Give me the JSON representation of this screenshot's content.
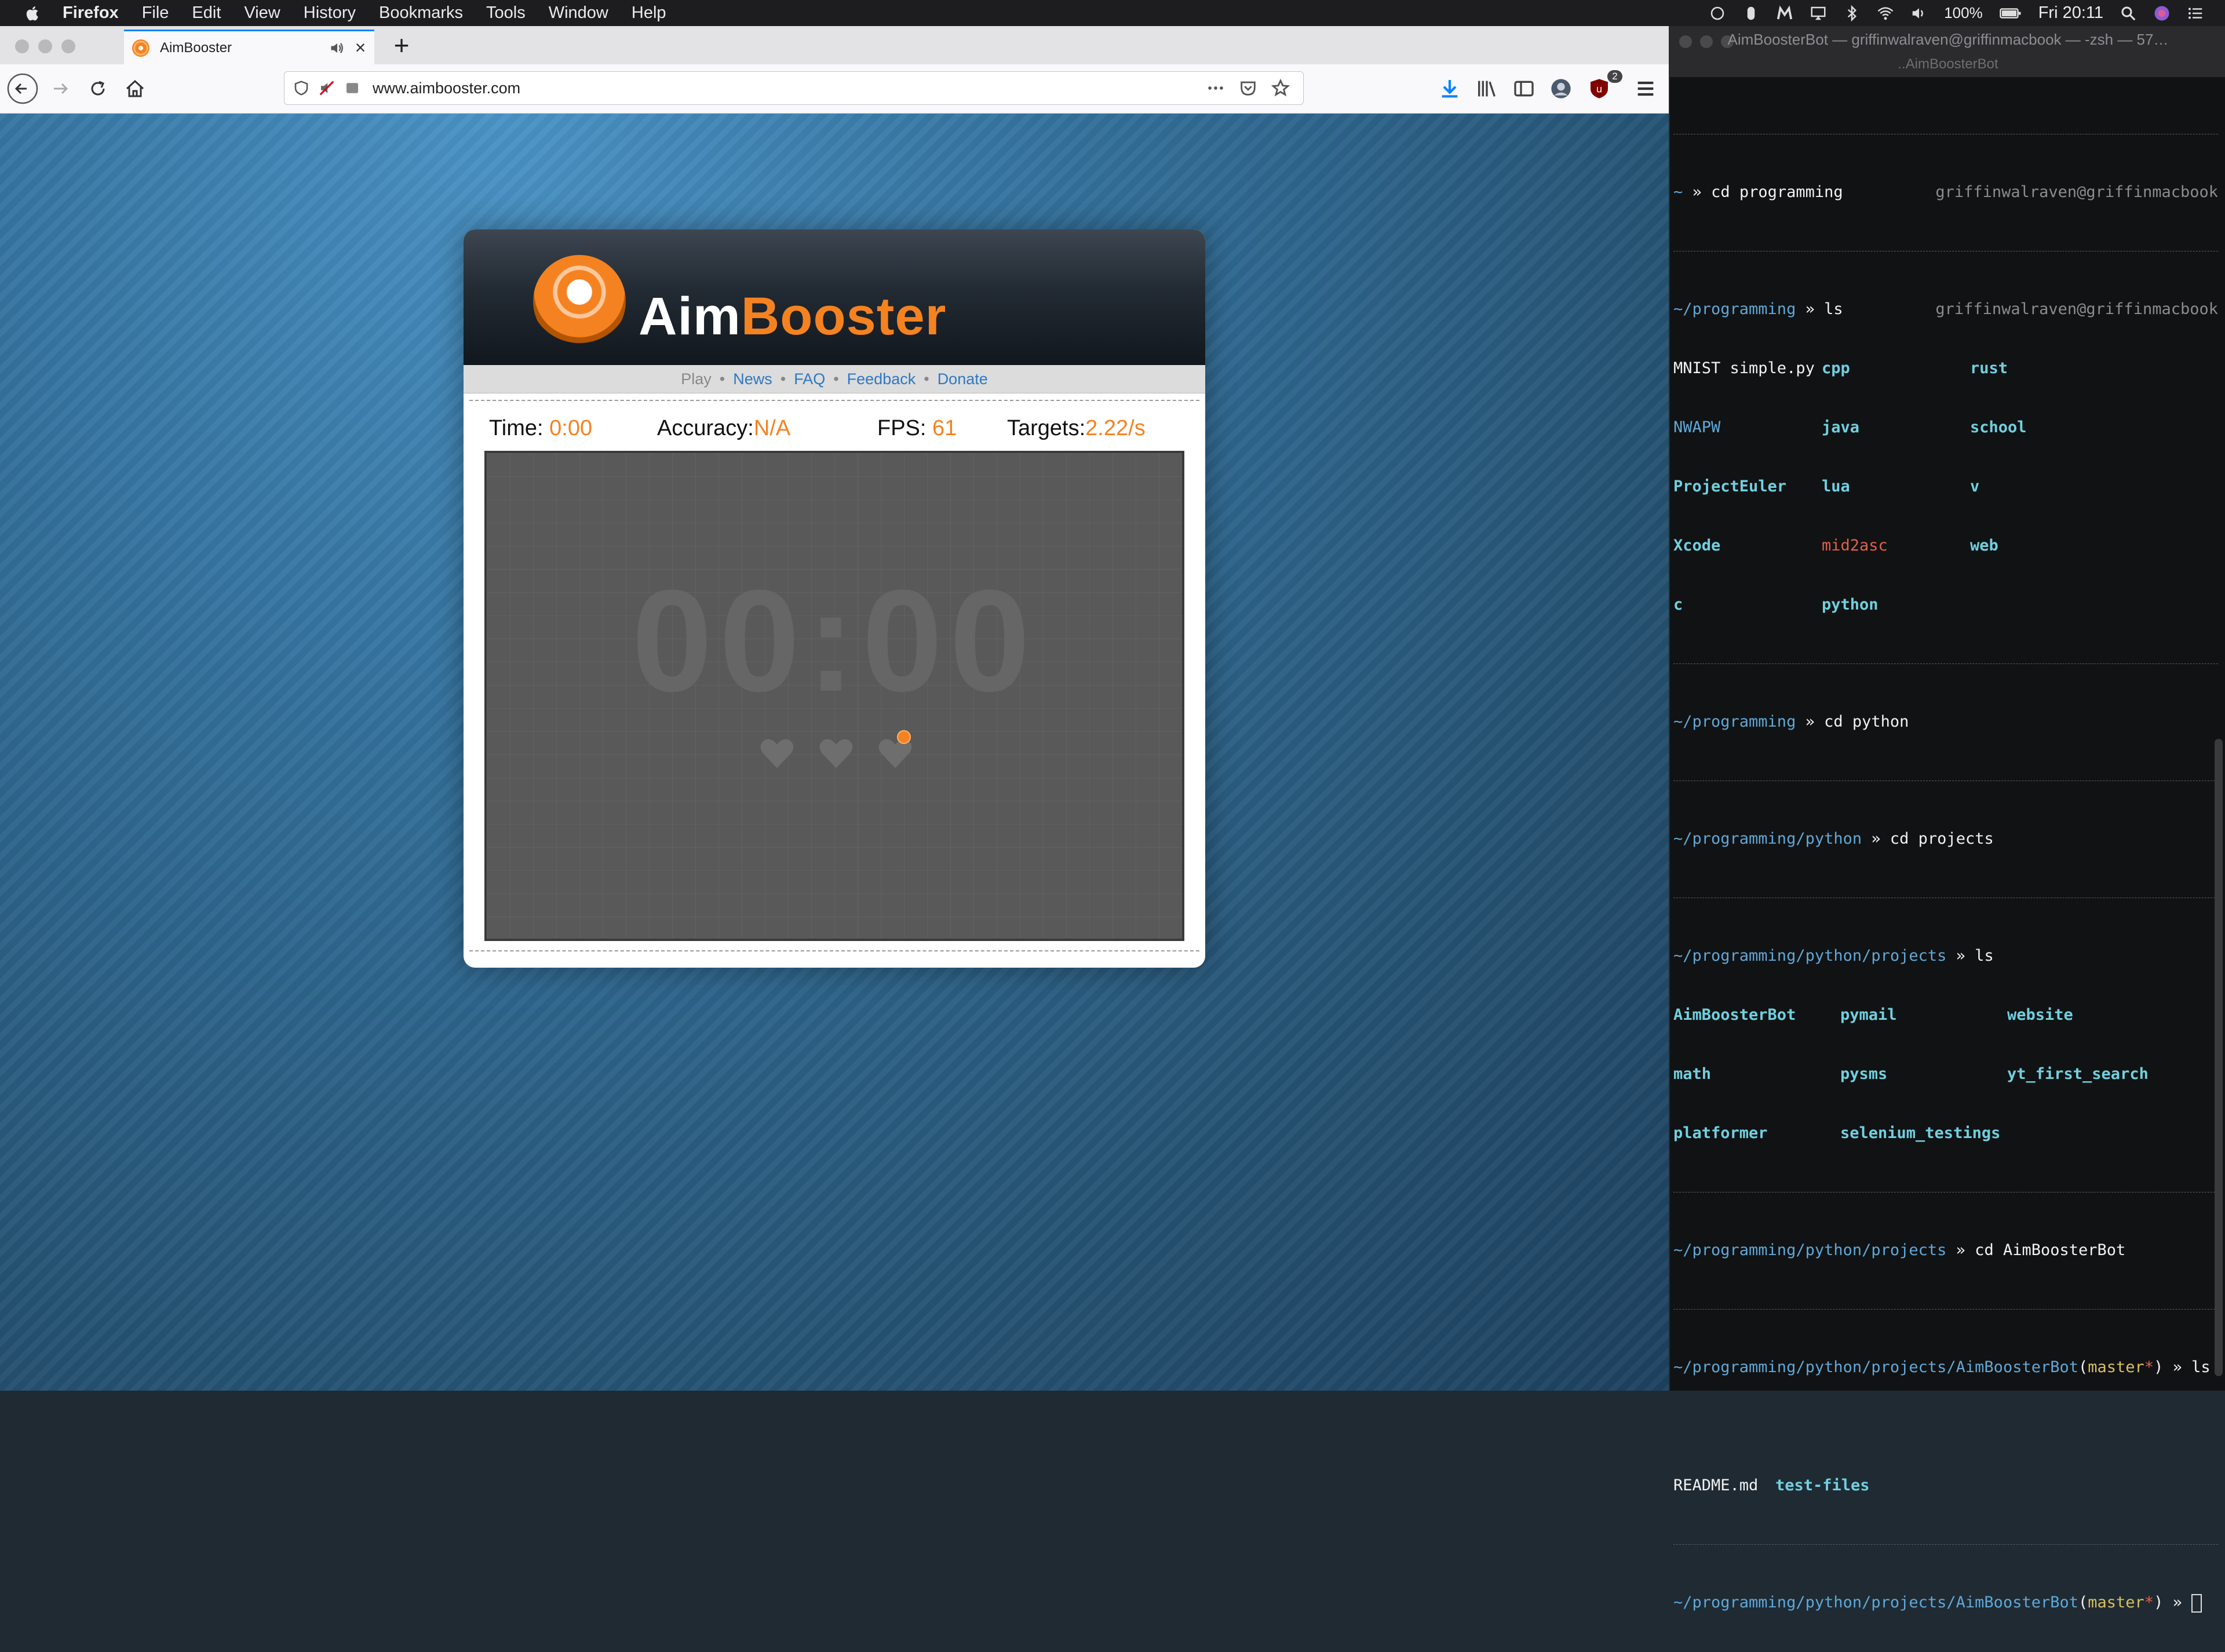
{
  "menubar": {
    "app_name": "Firefox",
    "menus": [
      "File",
      "Edit",
      "View",
      "History",
      "Bookmarks",
      "Tools",
      "Window",
      "Help"
    ],
    "battery": "100%",
    "clock": "Fri 20:11"
  },
  "browser": {
    "tab_title": "AimBooster",
    "url": "www.aimbooster.com"
  },
  "aimbooster": {
    "logo_aim": "Aim",
    "logo_booster": "Booster",
    "nav": {
      "play": "Play",
      "news": "News",
      "faq": "FAQ",
      "feedback": "Feedback",
      "donate": "Donate",
      "separator": "•"
    },
    "stats": {
      "time_label": "Time:",
      "time_value": "0:00",
      "accuracy_label": "Accuracy:",
      "accuracy_value": "N/A",
      "fps_label": "FPS:",
      "fps_value": "61",
      "targets_label": "Targets:",
      "targets_value": "2.22/s"
    },
    "big_timer": "00:00",
    "lives": 3,
    "accent_color": "#f58220"
  },
  "terminal": {
    "window_title": "AimBoosterBot — griffinwalraven@griffinmacbook — -zsh — 57…",
    "tab_title": "..AimBoosterBot",
    "host": "griffinwalraven@griffinmacbook",
    "prompts": {
      "home": "~",
      "programming": "~/programming",
      "python": "~/programming/python",
      "projects": "~/programming/python/projects",
      "bot": "~/programming/python/projects/AimBoosterBot"
    },
    "arrow": "»",
    "commands": {
      "cd_programming": "cd programming",
      "ls1": "ls",
      "cd_python": "cd python",
      "cd_projects": "cd projects",
      "ls2": "ls",
      "cd_bot": "cd AimBoosterBot",
      "ls3": "ls"
    },
    "git_branch": "master",
    "git_dirty": "*",
    "ls_programming": {
      "col1": [
        "MNIST simple.py",
        "NWAPW",
        "ProjectEuler",
        "Xcode",
        "c"
      ],
      "col2": [
        "cpp",
        "java",
        "lua",
        "mid2asc",
        "python"
      ],
      "col3": [
        "rust",
        "school",
        "v",
        "web"
      ]
    },
    "ls_projects": {
      "col1": [
        "AimBoosterBot",
        "math",
        "platformer"
      ],
      "col2": [
        "pymail",
        "pysms",
        "selenium_testings"
      ],
      "col3": [
        "website",
        "yt_first_search"
      ]
    },
    "ls_bot": {
      "file": "README.md",
      "dir": "test-files"
    }
  }
}
